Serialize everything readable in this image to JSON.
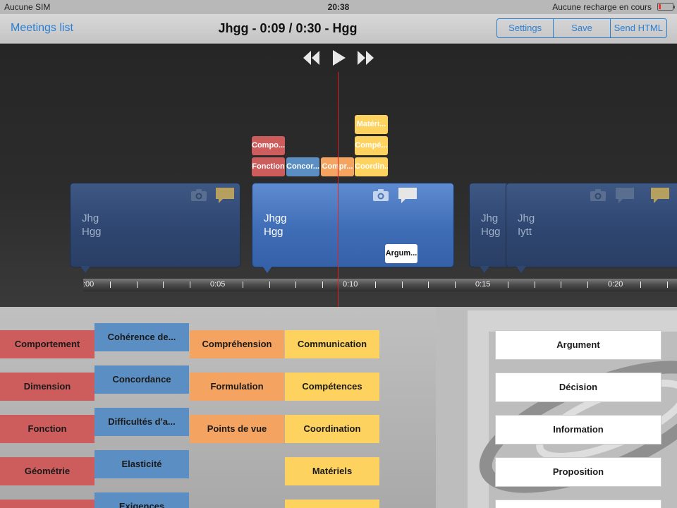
{
  "status": {
    "carrier": "Aucune SIM",
    "time": "20:38",
    "charging": "Aucune recharge en cours"
  },
  "nav": {
    "back": "Meetings list",
    "title": "Jhgg -  0:09 / 0:30  - Hgg",
    "settings": "Settings",
    "save": "Save",
    "send": "Send HTML"
  },
  "timeline_tags": [
    {
      "label": "Matéri...",
      "color": "#fdd25e"
    },
    {
      "label": "Compo...",
      "color": "#cd5c5c"
    },
    {
      "label": "Compé...",
      "color": "#fdd25e"
    },
    {
      "label": "Fonction",
      "color": "#cd5c5c"
    },
    {
      "label": "Concor...",
      "color": "#5b8fc4"
    },
    {
      "label": "Compr...",
      "color": "#f4a460"
    },
    {
      "label": "Coordin...",
      "color": "#fdd25e"
    }
  ],
  "clips": [
    {
      "line1": "Jhg",
      "line2": "Hgg"
    },
    {
      "line1": "Jhgg",
      "line2": "Hgg",
      "tag": "Argum..."
    },
    {
      "line1": "Jhg",
      "line2": "Hgg"
    },
    {
      "line1": "Jhg",
      "line2": "Iytt"
    }
  ],
  "ruler": {
    "labels": [
      ":00",
      "0:05",
      "0:10",
      "0:15",
      "0:20"
    ]
  },
  "palette": {
    "red": [
      "Comportement",
      "Dimension",
      "Fonction",
      "Géométrie",
      ""
    ],
    "blue": [
      "Cohérence de...",
      "Concordance",
      "Difficultés d'a...",
      "Elasticité",
      "Exigences"
    ],
    "orange": [
      "Compréhension",
      "Formulation",
      "Points de vue"
    ],
    "yellow": [
      "Communication",
      "Compétences",
      "Coordination",
      "Matériels",
      ""
    ],
    "white": [
      "Argument",
      "Décision",
      "Information",
      "Proposition",
      ""
    ]
  },
  "colors": {
    "red": "#cd5c5c",
    "blue": "#5b8fc4",
    "orange": "#f4a460",
    "yellow": "#fdd25e",
    "accent": "#2a7fd4",
    "playhead": "#e02424"
  }
}
